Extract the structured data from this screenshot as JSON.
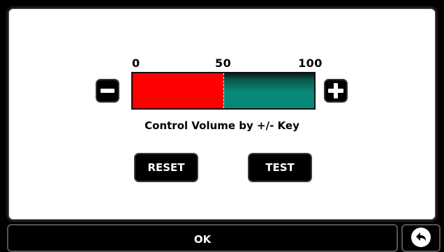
{
  "volume": {
    "scale_labels": [
      "0",
      "50",
      "100"
    ],
    "level_percent": 50,
    "fill_color": "#ff0000",
    "track_color": "#008b7a",
    "caption": "Control Volume by +/- Key"
  },
  "controls": {
    "decrease_icon": "minus-icon",
    "increase_icon": "plus-icon",
    "reset_label": "RESET",
    "test_label": "TEST"
  },
  "footer": {
    "ok_label": "OK",
    "back_icon": "back-arrow-icon"
  }
}
